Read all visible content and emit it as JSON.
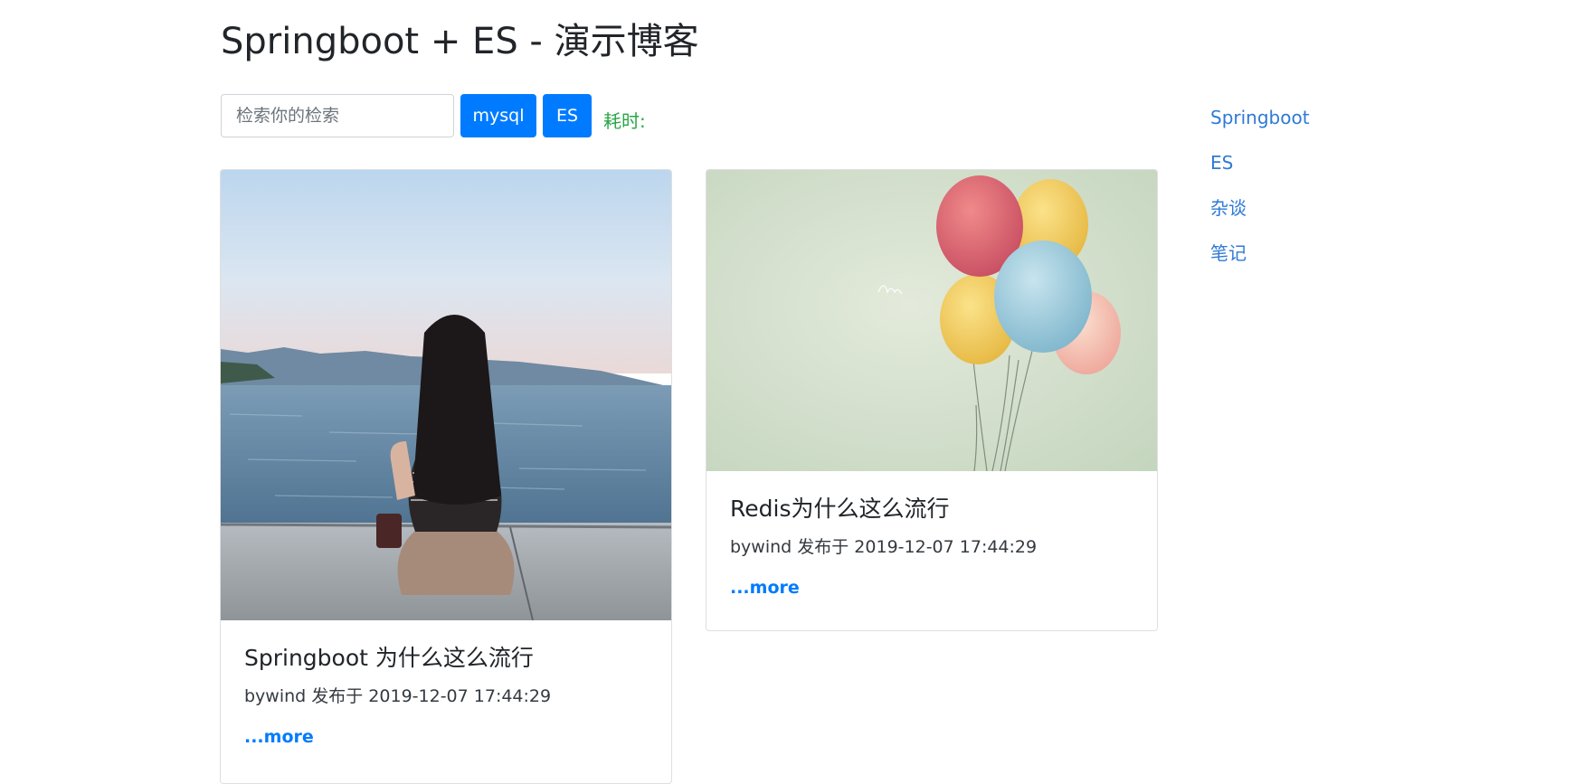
{
  "header": {
    "title": "Springboot + ES - 演示博客"
  },
  "search": {
    "placeholder": "检索你的检索",
    "value": "",
    "mysql_label": "mysql",
    "es_label": "ES",
    "elapsed_label": "耗时:"
  },
  "posts": [
    {
      "title": "Springboot 为什么这么流行",
      "meta": "bywind 发布于 2019-12-07 17:44:29",
      "more": "...more"
    },
    {
      "title": "Redis为什么这么流行",
      "meta": "bywind 发布于 2019-12-07 17:44:29",
      "more": "...more"
    }
  ],
  "sidebar": {
    "items": [
      {
        "label": "Springboot"
      },
      {
        "label": "ES"
      },
      {
        "label": "杂谈"
      },
      {
        "label": "笔记"
      }
    ]
  },
  "colors": {
    "accent": "#007bff",
    "elapsed": "#28a745",
    "link": "#2f7ad6"
  }
}
